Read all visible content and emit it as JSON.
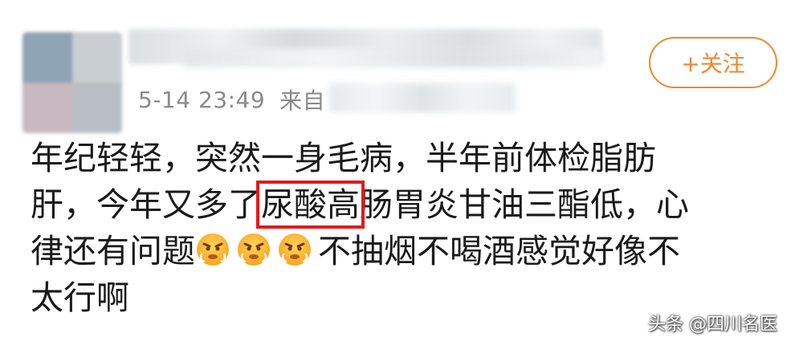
{
  "post": {
    "timestamp": "5-14 23:49",
    "source_prefix": "来自",
    "follow_label": "+关注",
    "lines": [
      "年纪轻轻，突然一身毛病，半年前体检脂肪",
      {
        "before": "肝，今年又多了",
        "highlight": "尿酸高",
        "after": "肠胃炎甘油三酯低，心"
      },
      {
        "before": "律还有问题",
        "after": "不抽烟不喝酒感觉好像不"
      },
      "太行啊"
    ],
    "emojis": [
      "angry-face-emoji",
      "angry-face-emoji",
      "angry-face-emoji"
    ],
    "highlight_color": "#e3191b",
    "accent_color": "#f0872f"
  },
  "watermark": "头条 @四川名医"
}
